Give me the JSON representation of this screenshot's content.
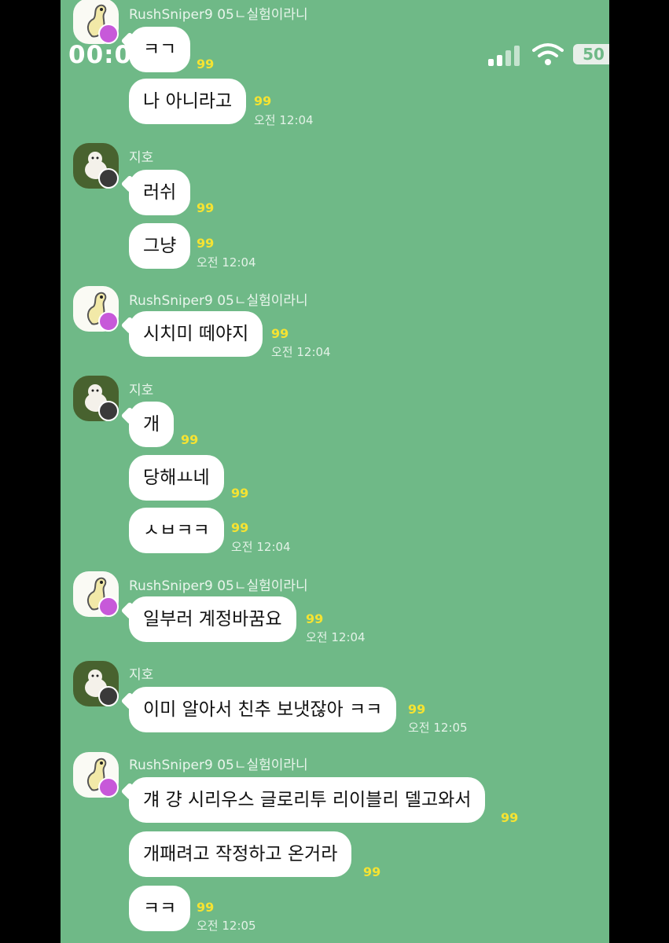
{
  "status_bar": {
    "time": "00:0",
    "battery": "50"
  },
  "colors": {
    "chat_bg": "#6fb987",
    "unread": "#f5e332",
    "crown_badge": "#c759d9"
  },
  "messages": [
    {
      "sender": "RushSniper9 05ㄴ실험이라니",
      "avatar": "rush",
      "bubbles": [
        {
          "text": "ㅋㄱ",
          "unread": "99"
        },
        {
          "text": "나 아니라고",
          "unread": "99",
          "time": "오전 12:04"
        }
      ]
    },
    {
      "sender": "지호",
      "avatar": "jiho",
      "bubbles": [
        {
          "text": "러쉬",
          "unread": "99"
        },
        {
          "text": "그냥",
          "unread": "99",
          "time": "오전 12:04"
        }
      ]
    },
    {
      "sender": "RushSniper9 05ㄴ실험이라니",
      "avatar": "rush",
      "bubbles": [
        {
          "text": "시치미 떼야지",
          "unread": "99",
          "time": "오전 12:04"
        }
      ]
    },
    {
      "sender": "지호",
      "avatar": "jiho",
      "bubbles": [
        {
          "text": "개",
          "unread": "99"
        },
        {
          "text": "당해ㅛ네",
          "unread": "99"
        },
        {
          "text": "ㅅㅂㅋㅋ",
          "unread": "99",
          "time": "오전 12:04"
        }
      ]
    },
    {
      "sender": "RushSniper9 05ㄴ실험이라니",
      "avatar": "rush",
      "bubbles": [
        {
          "text": "일부러 계정바꿈요",
          "unread": "99",
          "time": "오전 12:04"
        }
      ]
    },
    {
      "sender": "지호",
      "avatar": "jiho",
      "bubbles": [
        {
          "text": "이미 알아서 친추 보냇잖아 ㅋㅋ",
          "unread": "99",
          "time": "오전 12:05"
        }
      ]
    },
    {
      "sender": "RushSniper9 05ㄴ실험이라니",
      "avatar": "rush",
      "bubbles": [
        {
          "text": "걔 걍 시리우스 글로리투 리이블리 델고와서",
          "unread": "99"
        },
        {
          "text": "개패려고 작정하고 온거라",
          "unread": "99"
        },
        {
          "text": "ㅋㅋ",
          "unread": "99",
          "time": "오전 12:05"
        }
      ]
    }
  ]
}
